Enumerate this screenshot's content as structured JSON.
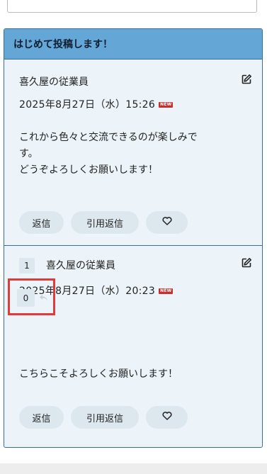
{
  "thread": {
    "title": "はじめて投稿します！"
  },
  "posts": [
    {
      "author": "喜久屋の従業員",
      "datetime": "2025年8月27日（水）15:26",
      "new_label": "NEW",
      "body_lines": [
        "これから色々と交流できるのが楽しみで",
        "す。",
        "どうぞよろしくお願いします！"
      ],
      "actions": {
        "reply": "返信",
        "quote_reply": "引用返信"
      }
    },
    {
      "number": "1",
      "author": "喜久屋の従業員",
      "datetime": "2025年8月27日（水）20:23",
      "new_label": "NEW",
      "reaction_count": "0",
      "body_lines": [
        "こちらこそよろしくお願いします！"
      ],
      "actions": {
        "reply": "返信",
        "quote_reply": "引用返信"
      }
    }
  ],
  "icons": {
    "edit": "edit-icon",
    "like": "heart-icon",
    "reply_arrow": "reply-arrow-icon"
  },
  "colors": {
    "header_bg": "#64a7d6",
    "card_bg": "#edf4f9",
    "border": "#3a6e99",
    "button_bg": "#dde7ee",
    "new_badge": "#c5302f",
    "highlight": "#e03a3a"
  }
}
